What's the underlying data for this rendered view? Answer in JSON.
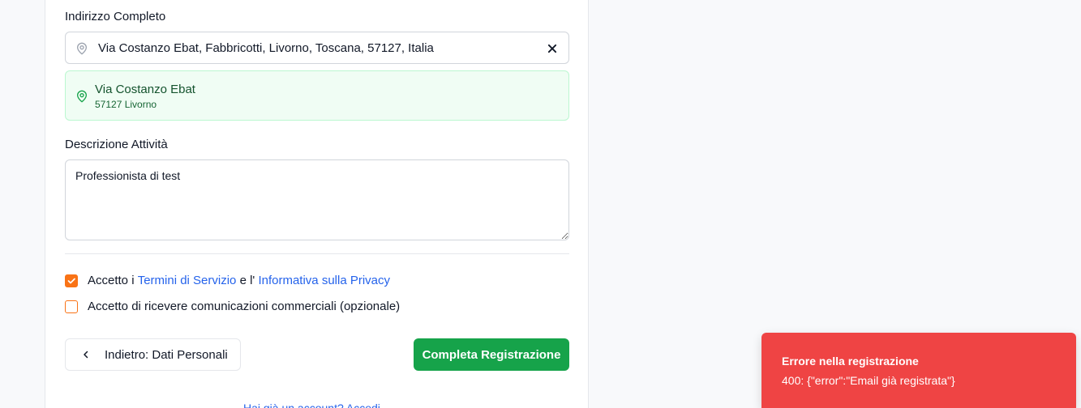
{
  "address": {
    "label": "Indirizzo Completo",
    "value": "Via Costanzo Ebat, Fabbricotti, Livorno, Toscana, 57127, Italia",
    "suggestion_street": "Via Costanzo Ebat",
    "suggestion_city": "57127 Livorno"
  },
  "description": {
    "label": "Descrizione Attività",
    "value": "Professionista di test"
  },
  "consents": {
    "terms_prefix": "Accetto i ",
    "terms_link": "Termini di Servizio",
    "terms_mid": " e l' ",
    "privacy_link": "Informativa sulla Privacy",
    "terms_checked": true,
    "marketing_label": "Accetto di ricevere comunicazioni commerciali (opzionale)",
    "marketing_checked": false
  },
  "actions": {
    "back_label": "Indietro: Dati Personali",
    "submit_label": "Completa Registrazione"
  },
  "footer": {
    "partial_text": "Hai già un account? Accedi"
  },
  "toast": {
    "title": "Errore nella registrazione",
    "message": "400: {\"error\":\"Email già registrata\"}"
  },
  "colors": {
    "accent_orange": "#f97316",
    "success_green": "#16a34a",
    "link_blue": "#2563eb",
    "error_red": "#ef4444"
  },
  "icons": [
    "map-pin-icon",
    "close-icon",
    "check-icon",
    "chevron-left-icon"
  ]
}
